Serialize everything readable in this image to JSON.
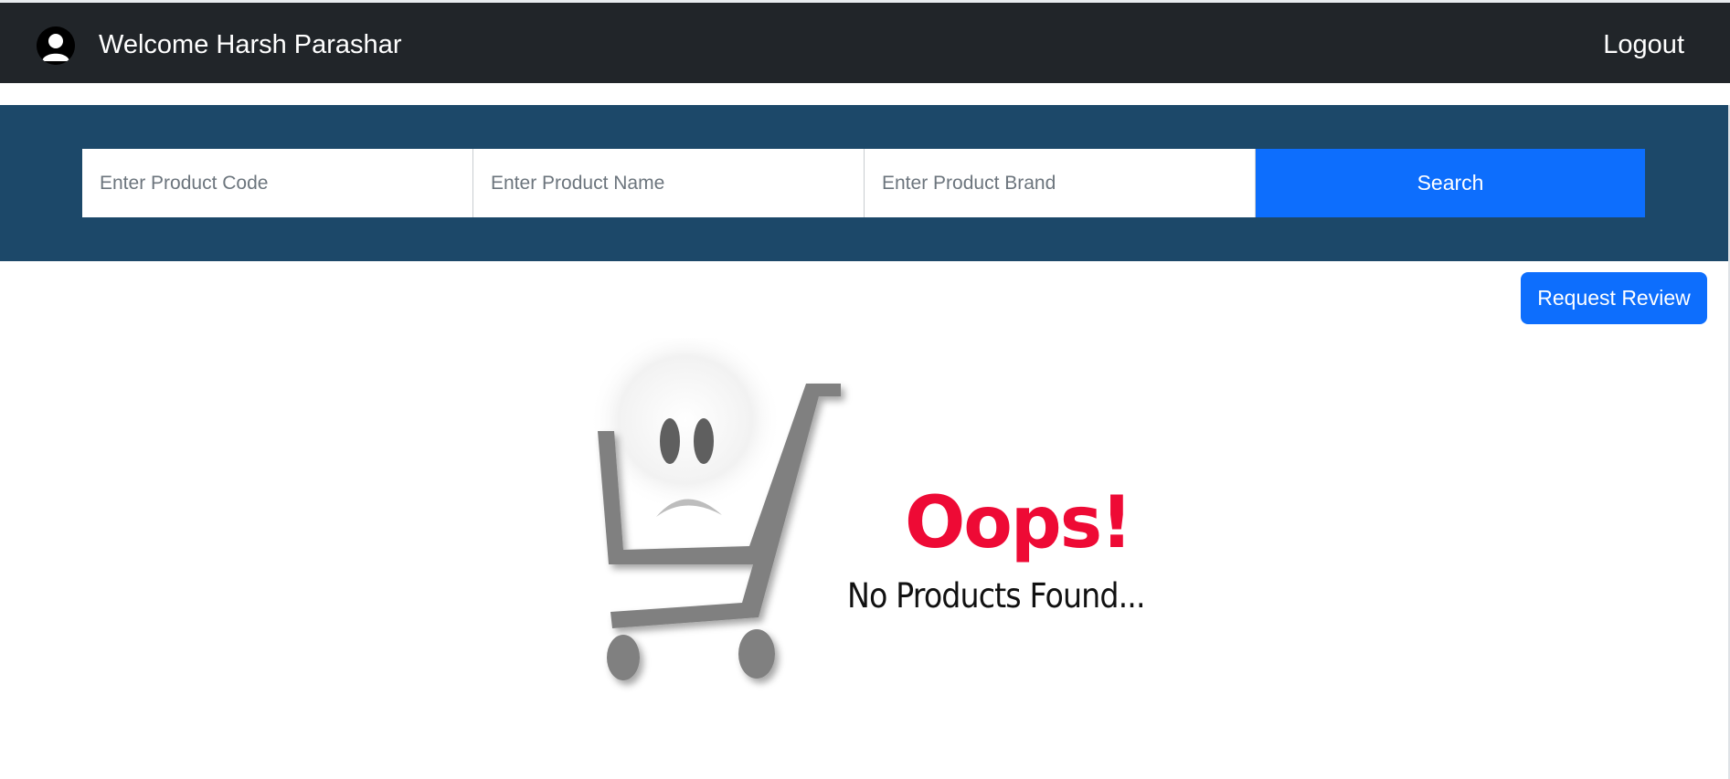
{
  "navbar": {
    "welcome_text": "Welcome Harsh Parashar",
    "logout_label": "Logout",
    "avatar_icon": "user-avatar-icon",
    "background": "#212529"
  },
  "search": {
    "code_placeholder": "Enter Product Code",
    "name_placeholder": "Enter Product Name",
    "brand_placeholder": "Enter Product Brand",
    "button_label": "Search",
    "band_color": "#1c4869",
    "button_color": "#0d6efd"
  },
  "actions": {
    "request_review_label": "Request Review"
  },
  "empty_state": {
    "illustration": "sad-shopping-cart-icon",
    "headline": "Oops!",
    "message": "No Products Found...",
    "headline_color": "#ee0a35"
  }
}
